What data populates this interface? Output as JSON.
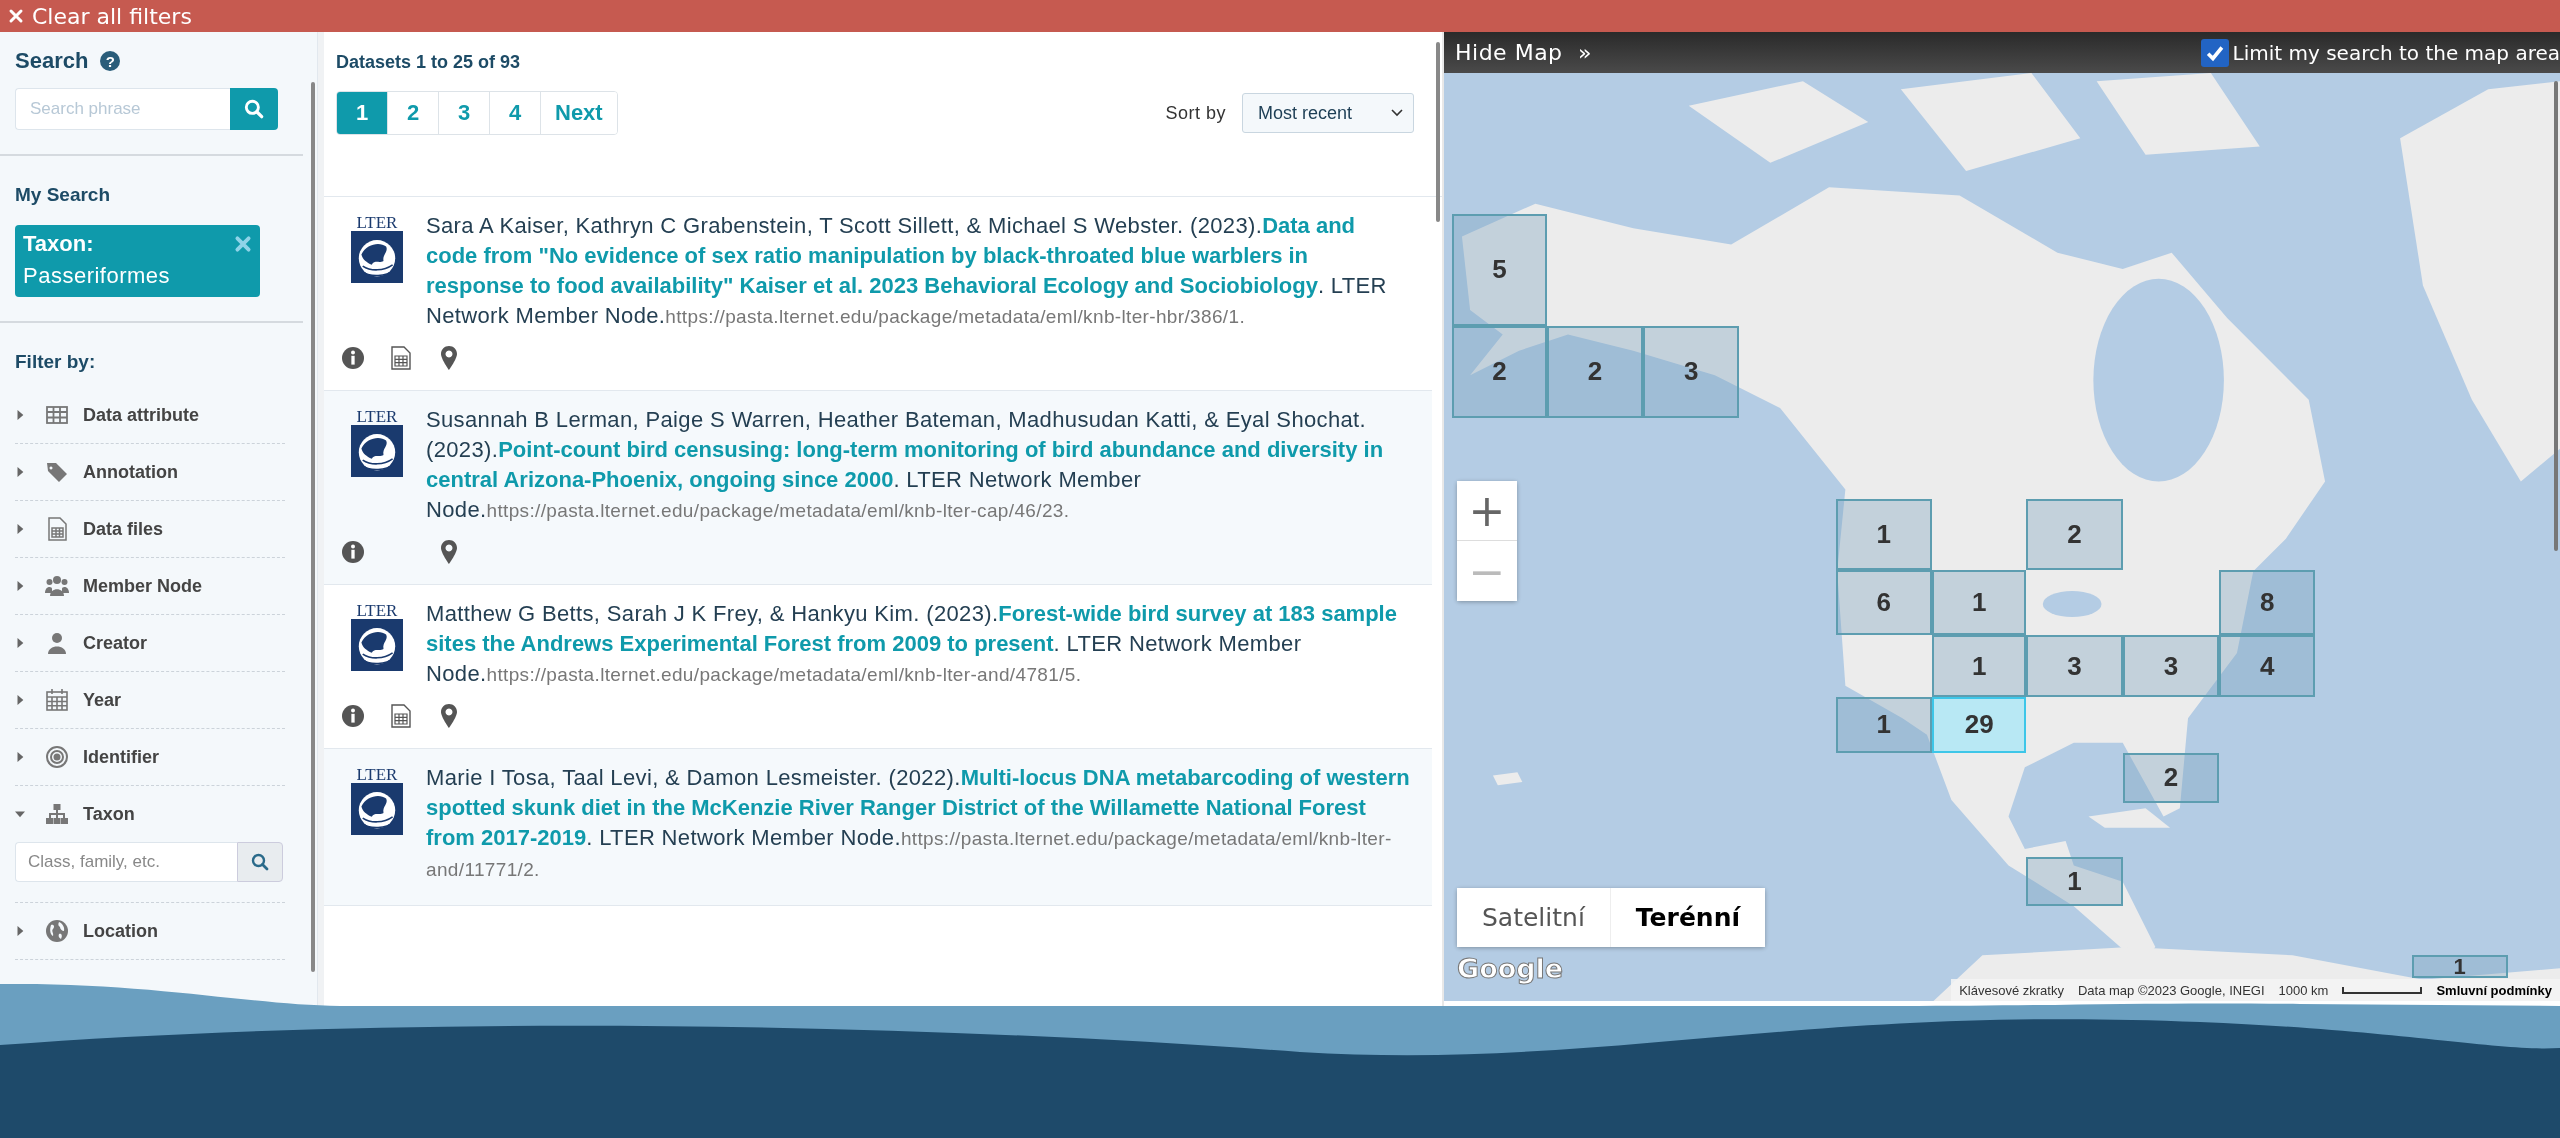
{
  "clear_filters": "Clear all filters",
  "sidebar": {
    "search_title": "Search",
    "help": "?",
    "search_placeholder": "Search phrase",
    "my_search_title": "My Search",
    "chips": [
      {
        "field": "Taxon:",
        "value": "Passeriformes"
      }
    ],
    "filter_title": "Filter by:",
    "filters": [
      {
        "label": "Data attribute",
        "expanded": false
      },
      {
        "label": "Annotation",
        "expanded": false
      },
      {
        "label": "Data files",
        "expanded": false
      },
      {
        "label": "Member Node",
        "expanded": false
      },
      {
        "label": "Creator",
        "expanded": false
      },
      {
        "label": "Year",
        "expanded": false
      },
      {
        "label": "Identifier",
        "expanded": false
      },
      {
        "label": "Taxon",
        "expanded": true,
        "placeholder": "Class, family, etc."
      },
      {
        "label": "Location",
        "expanded": false
      }
    ]
  },
  "results": {
    "summary": "Datasets 1 to 25 of 93",
    "pages": [
      {
        "label": "1",
        "selected": true
      },
      {
        "label": "2",
        "selected": false
      },
      {
        "label": "3",
        "selected": false
      },
      {
        "label": "4",
        "selected": false
      },
      {
        "label": "Next",
        "selected": false
      }
    ],
    "sort_label": "Sort by",
    "sort_value": "Most recent",
    "items": [
      {
        "logo": "LTER",
        "authors": "Sara A Kaiser, Kathryn C Grabenstein, T Scott Sillett, & Michael S Webster. (2023).",
        "title": "Data and code from \"No evidence of sex ratio manipulation by black-throated blue warblers in response to food availability\" Kaiser et al. 2023 Behavioral Ecology and Sociobiology",
        "publisher": ". LTER Network Member Node.",
        "url": "https://pasta.lternet.edu/package/metadata/eml/knb-lter-hbr/386/1.",
        "icons": {
          "info": true,
          "data_files": true,
          "location": true
        }
      },
      {
        "logo": "LTER",
        "authors": "Susannah B Lerman, Paige S Warren, Heather Bateman, Madhusudan Katti, & Eyal Shochat. (2023).",
        "title": "Point-count bird censusing: long-term monitoring of bird abundance and diversity in central Arizona-Phoenix, ongoing since 2000",
        "publisher": ". LTER Network Member Node.",
        "url": "https://pasta.lternet.edu/package/metadata/eml/knb-lter-cap/46/23.",
        "icons": {
          "info": true,
          "data_files": false,
          "location": true
        }
      },
      {
        "logo": "LTER",
        "authors": "Matthew G Betts, Sarah J K Frey, & Hankyu Kim. (2023).",
        "title": "Forest-wide bird survey at 183 sample sites the Andrews Experimental Forest from 2009 to present",
        "publisher": ". LTER Network Member Node.",
        "url": "https://pasta.lternet.edu/package/metadata/eml/knb-lter-and/4781/5.",
        "icons": {
          "info": true,
          "data_files": true,
          "location": true
        }
      },
      {
        "logo": "LTER",
        "authors": "Marie I Tosa, Taal Levi, & Damon Lesmeister. (2022).",
        "title": "Multi-locus DNA metabarcoding of western spotted skunk diet in the McKenzie River Ranger District of the Willamette National Forest from 2017-2019",
        "publisher": ". LTER Network Member Node.",
        "url": "https://pasta.lternet.edu/package/metadata/eml/knb-lter-and/11771/2."
      }
    ]
  },
  "map": {
    "hide_label": "Hide Map",
    "hide_icon": "»",
    "limit_label": "Limit my search to the map area",
    "limit_checked": true,
    "zoom_in": "+",
    "zoom_out": "−",
    "map_types": [
      {
        "label": "Satelitní",
        "selected": false
      },
      {
        "label": "Terénní",
        "selected": true
      }
    ],
    "logo": "Google",
    "attribution": [
      "Klávesové zkratky",
      "Data map ©2023 Google, INEGI"
    ],
    "scale": "1000 km",
    "terms": "Smluvní podmínky",
    "clusters": [
      {
        "count": "5",
        "selected": false
      },
      {
        "count": "2",
        "selected": false
      },
      {
        "count": "2",
        "selected": false
      },
      {
        "count": "3",
        "selected": false
      },
      {
        "count": "1",
        "selected": false
      },
      {
        "count": "2",
        "selected": false
      },
      {
        "count": "6",
        "selected": false
      },
      {
        "count": "1",
        "selected": false
      },
      {
        "count": "8",
        "selected": false
      },
      {
        "count": "1",
        "selected": false
      },
      {
        "count": "3",
        "selected": false
      },
      {
        "count": "3",
        "selected": false
      },
      {
        "count": "4",
        "selected": false
      },
      {
        "count": "1",
        "selected": false
      },
      {
        "count": "29",
        "selected": true
      },
      {
        "count": "2",
        "selected": false
      },
      {
        "count": "1",
        "selected": false
      },
      {
        "count": "1",
        "selected": false
      }
    ]
  }
}
